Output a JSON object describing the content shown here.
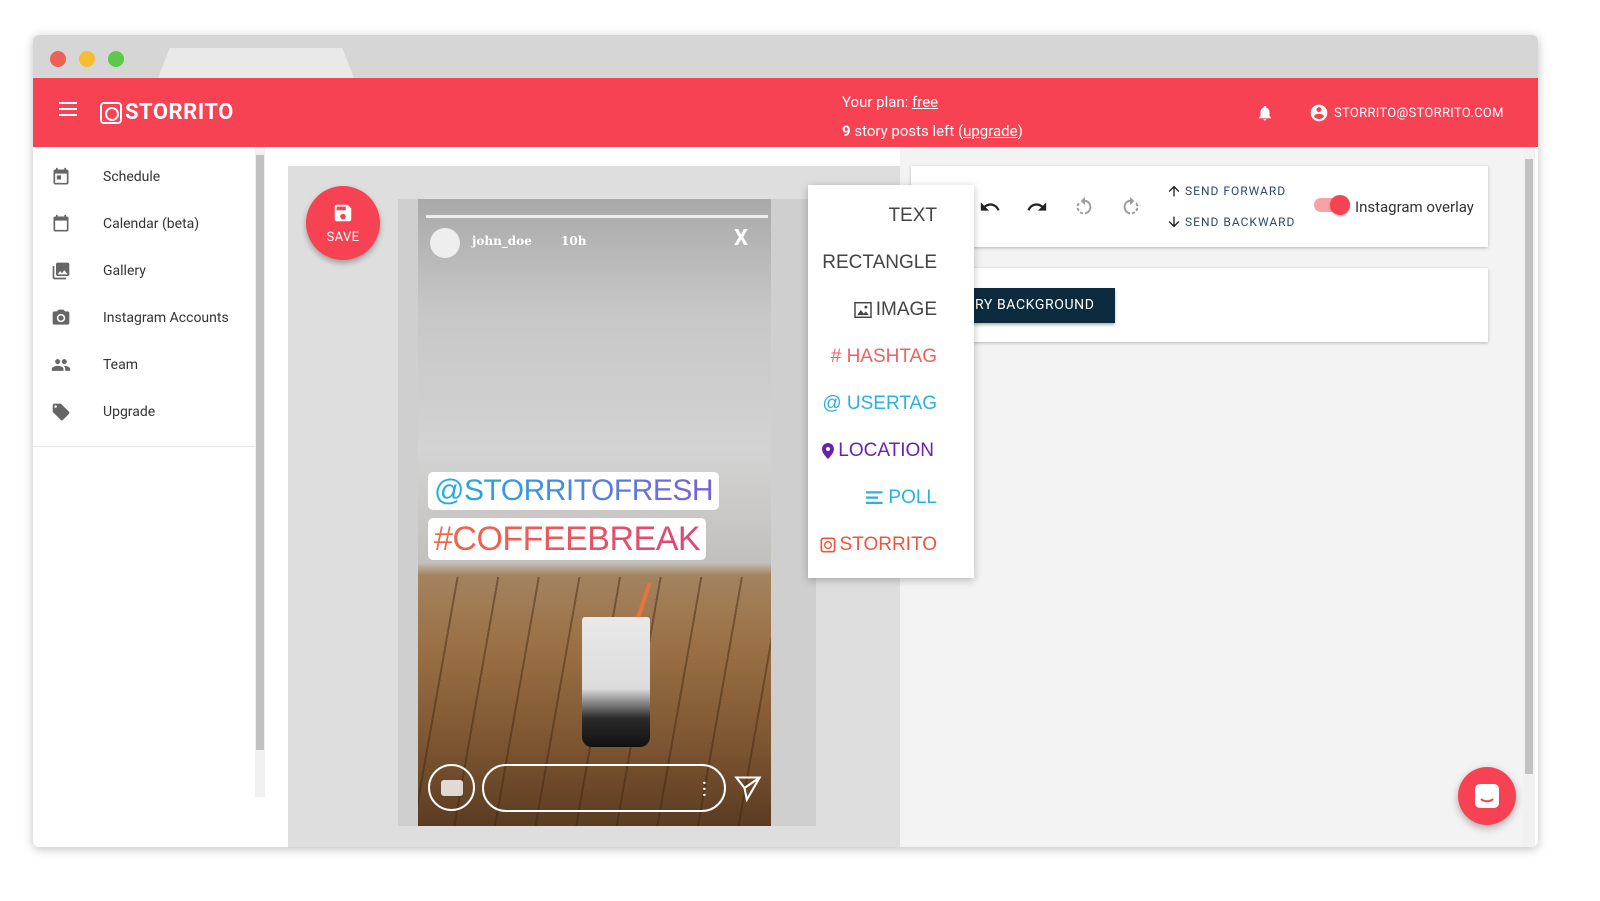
{
  "colors": {
    "brand": "#f64252",
    "dark_button": "#0d2b3e"
  },
  "header": {
    "app_name": "STORRITO",
    "plan_prefix": "Your plan: ",
    "plan_name": "free",
    "posts_count": "9",
    "posts_text": " story posts left (",
    "upgrade_link": "upgrade",
    "posts_suffix": ")",
    "account_email": "STORRITO@STORRITO.COM"
  },
  "sidebar": {
    "items": [
      {
        "label": "Schedule",
        "icon": "schedule-icon"
      },
      {
        "label": "Calendar (beta)",
        "icon": "calendar-icon"
      },
      {
        "label": "Gallery",
        "icon": "gallery-icon"
      },
      {
        "label": "Instagram Accounts",
        "icon": "camera-icon"
      },
      {
        "label": "Team",
        "icon": "team-icon"
      },
      {
        "label": "Upgrade",
        "icon": "tag-icon"
      }
    ]
  },
  "editor": {
    "save_label": "SAVE",
    "story": {
      "username": "john_doe",
      "time_ago": "10h",
      "close": "X",
      "usertag": "@STORRITOFRESH",
      "hashtag": "#COFFEEBREAK"
    }
  },
  "toolbar": {
    "send_forward": "SEND FORWARD",
    "send_backward": "SEND BACKWARD",
    "overlay_label": "Instagram overlay",
    "overlay_on": true,
    "background_button": "RY BACKGROUND"
  },
  "add_menu": {
    "items": [
      {
        "label": "TEXT",
        "icon": ""
      },
      {
        "label": "RECTANGLE",
        "icon": ""
      },
      {
        "label": "IMAGE",
        "icon": "image-icon"
      },
      {
        "label": "# HASHTAG",
        "icon": ""
      },
      {
        "label": "@ USERTAG",
        "icon": ""
      },
      {
        "label": "LOCATION",
        "icon": "location-pin-icon"
      },
      {
        "label": "POLL",
        "icon": "poll-icon"
      },
      {
        "label": "STORRITO",
        "icon": "storrito-icon"
      }
    ]
  }
}
